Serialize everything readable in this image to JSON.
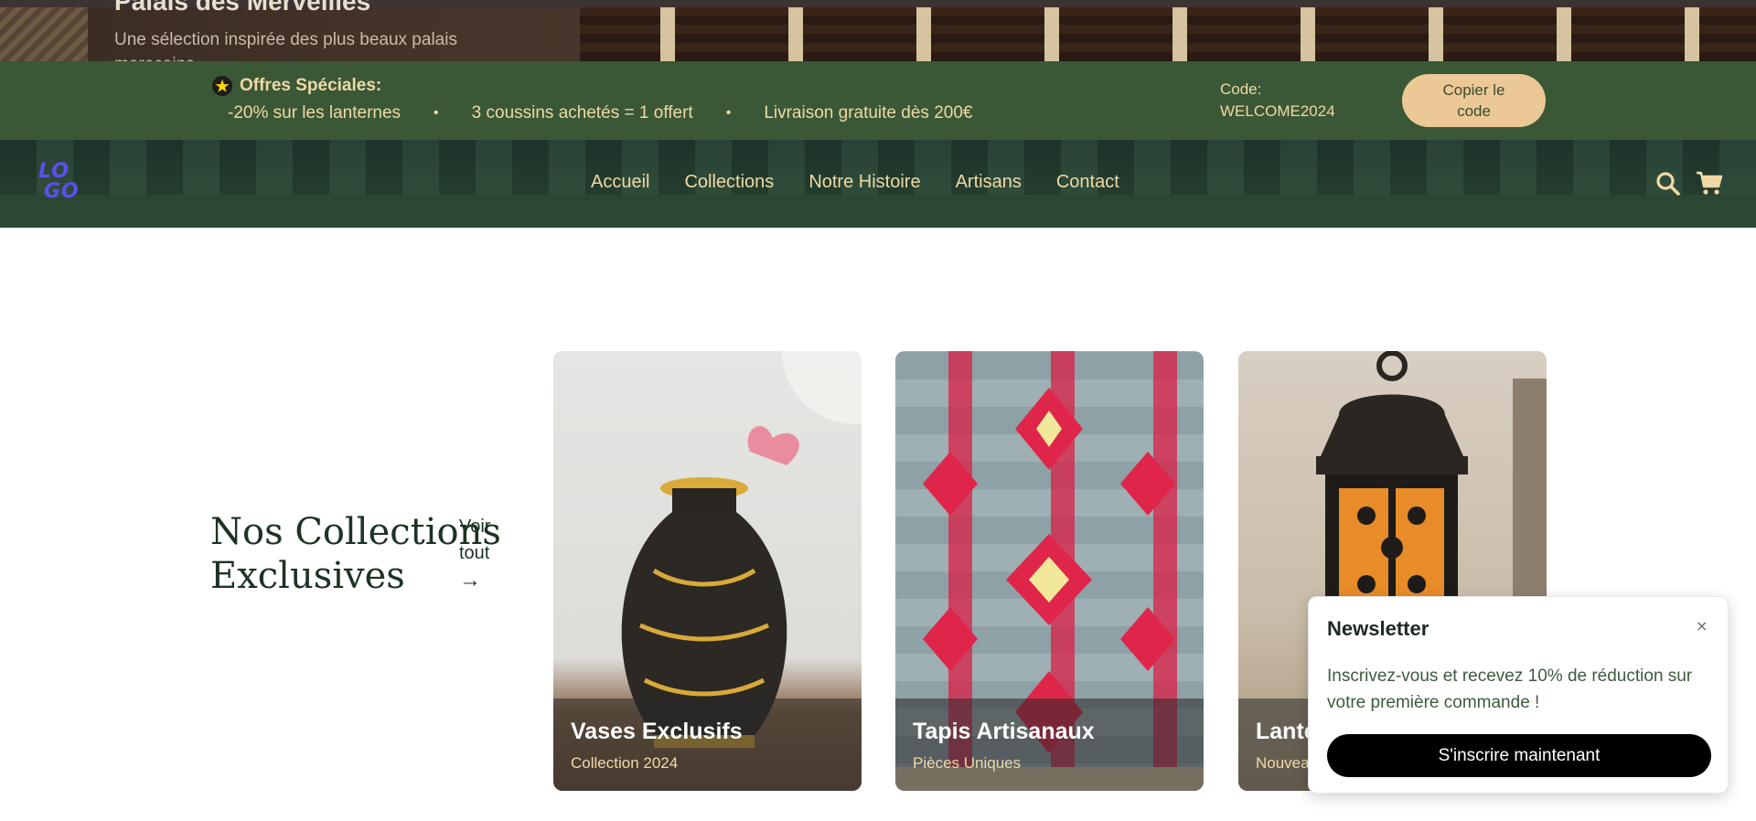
{
  "hero": {
    "title": "Palais des Merveilles",
    "subtitle_line1": "Une sélection inspirée des plus beaux palais",
    "subtitle_line2": "marocains"
  },
  "promo": {
    "title": "Offres Spéciales:",
    "star_icon": "star-icon",
    "offers": [
      "-20% sur les lanternes",
      "3 coussins achetés = 1 offert",
      "Livraison gratuite dès 200€"
    ],
    "separator": "•",
    "code_label": "Code:",
    "code_value": "WELCOME2024",
    "copy_button_line1": "Copier le",
    "copy_button_line2": "code",
    "colors": {
      "background": "#3a5836",
      "text": "#f0d9a6",
      "button": "#ecc896"
    }
  },
  "nav": {
    "logo_line1": "LO",
    "logo_line2": "GO",
    "links": [
      "Accueil",
      "Collections",
      "Notre Histoire",
      "Artisans",
      "Contact"
    ],
    "icons": [
      "search-icon",
      "cart-icon"
    ],
    "colors": {
      "background": "#2c4a33",
      "link": "#f0d9a6",
      "logo": "#5b4ff0"
    }
  },
  "collections": {
    "title_line1": "Nos Collections",
    "title_line2": "Exclusives",
    "see_all_line1": "Voir",
    "see_all_line2": "tout",
    "see_all_arrow": "→",
    "cards": [
      {
        "title": "Vases Exclusifs",
        "subtitle": "Collection 2024"
      },
      {
        "title": "Tapis Artisanaux",
        "subtitle": "Pièces Uniques"
      },
      {
        "title": "Lanternes",
        "subtitle": "Nouveautés"
      }
    ]
  },
  "newsletter": {
    "title": "Newsletter",
    "close": "×",
    "text": "Inscrivez-vous et recevez 10% de réduction sur votre première commande !",
    "button": "S'inscrire maintenant"
  }
}
